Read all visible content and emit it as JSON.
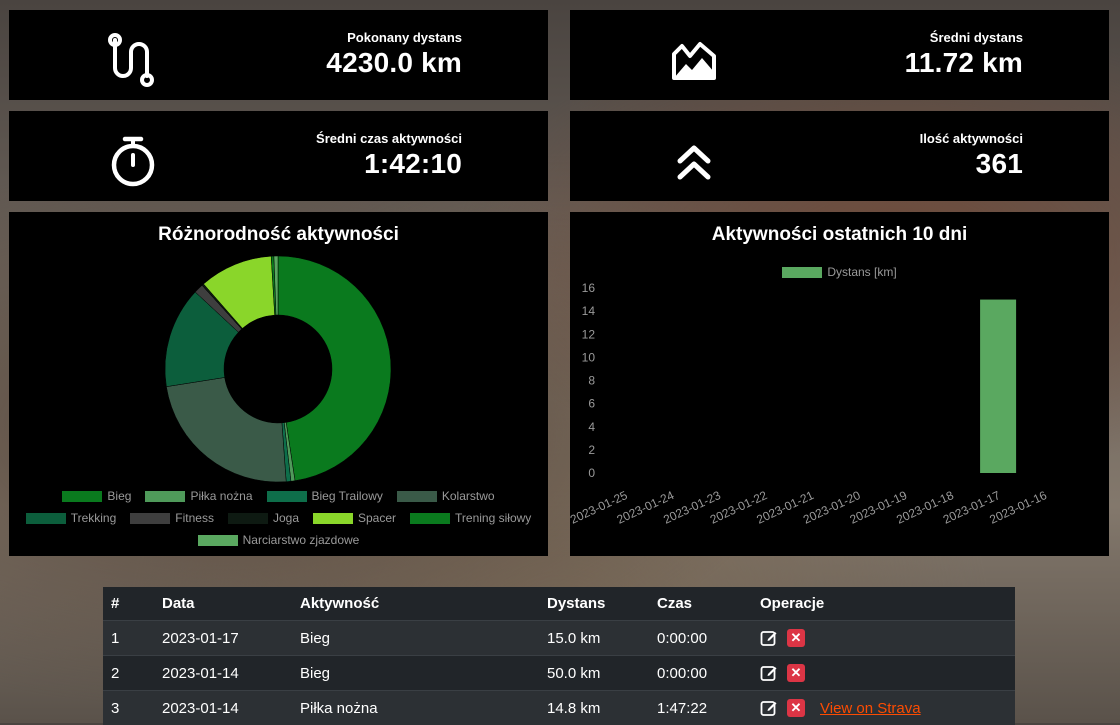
{
  "stats": [
    {
      "label": "Pokonany dystans",
      "value": "4230.0 km",
      "icon": "route-icon"
    },
    {
      "label": "Średni dystans",
      "value": "11.72 km",
      "icon": "mountain-icon"
    },
    {
      "label": "Średni czas aktywności",
      "value": "1:42:10",
      "icon": "stopwatch-icon"
    },
    {
      "label": "Ilość aktywności",
      "value": "361",
      "icon": "double-chevron-up-icon"
    }
  ],
  "donut": {
    "title": "Różnorodność aktywności",
    "legend": [
      {
        "label": "Bieg",
        "color": "#0a7a1e"
      },
      {
        "label": "Piłka nożna",
        "color": "#4f9a5a"
      },
      {
        "label": "Bieg Trailowy",
        "color": "#0e6e4a"
      },
      {
        "label": "Kolarstwo",
        "color": "#3a5a48"
      },
      {
        "label": "Trekking",
        "color": "#0c5e3c"
      },
      {
        "label": "Fitness",
        "color": "#3e3e3e"
      },
      {
        "label": "Joga",
        "color": "#0e1a12"
      },
      {
        "label": "Spacer",
        "color": "#8ad62a"
      },
      {
        "label": "Trening siłowy",
        "color": "#0a7a1e"
      },
      {
        "label": "Narciarstwo zjazdowe",
        "color": "#5aa860"
      }
    ]
  },
  "bar": {
    "title": "Aktywności ostatnich 10 dni",
    "legend": "Dystans [km]"
  },
  "chart_data": [
    {
      "type": "pie",
      "title": "Różnorodność aktywności",
      "categories": [
        "Bieg",
        "Piłka nożna",
        "Bieg Trailowy",
        "Kolarstwo",
        "Trekking",
        "Fitness",
        "Joga",
        "Spacer",
        "Trening siłowy",
        "Narciarstwo zjazdowe"
      ],
      "values": [
        49.5,
        0.6,
        0.7,
        24.6,
        15.0,
        1.4,
        0.3,
        10.9,
        0.4,
        0.6
      ]
    },
    {
      "type": "bar",
      "title": "Aktywności ostatnich 10 dni",
      "categories": [
        "2023-01-25",
        "2023-01-24",
        "2023-01-23",
        "2023-01-22",
        "2023-01-21",
        "2023-01-20",
        "2023-01-19",
        "2023-01-18",
        "2023-01-17",
        "2023-01-16"
      ],
      "series": [
        {
          "name": "Dystans [km]",
          "values": [
            0,
            0,
            0,
            0,
            0,
            0,
            0,
            0,
            15,
            0
          ]
        }
      ],
      "ylim": [
        0,
        16
      ],
      "yticks": [
        0,
        2,
        4,
        6,
        8,
        10,
        12,
        14,
        16
      ],
      "color": "#5aa860"
    }
  ],
  "table": {
    "headers": [
      "#",
      "Data",
      "Aktywność",
      "Dystans",
      "Czas",
      "Operacje"
    ],
    "rows": [
      {
        "num": "1",
        "date": "2023-01-17",
        "activity": "Bieg",
        "distance": "15.0 km",
        "time": "0:00:00",
        "link": ""
      },
      {
        "num": "2",
        "date": "2023-01-14",
        "activity": "Bieg",
        "distance": "50.0 km",
        "time": "0:00:00",
        "link": ""
      },
      {
        "num": "3",
        "date": "2023-01-14",
        "activity": "Piłka nożna",
        "distance": "14.8 km",
        "time": "1:47:22",
        "link": "View on Strava"
      }
    ]
  }
}
